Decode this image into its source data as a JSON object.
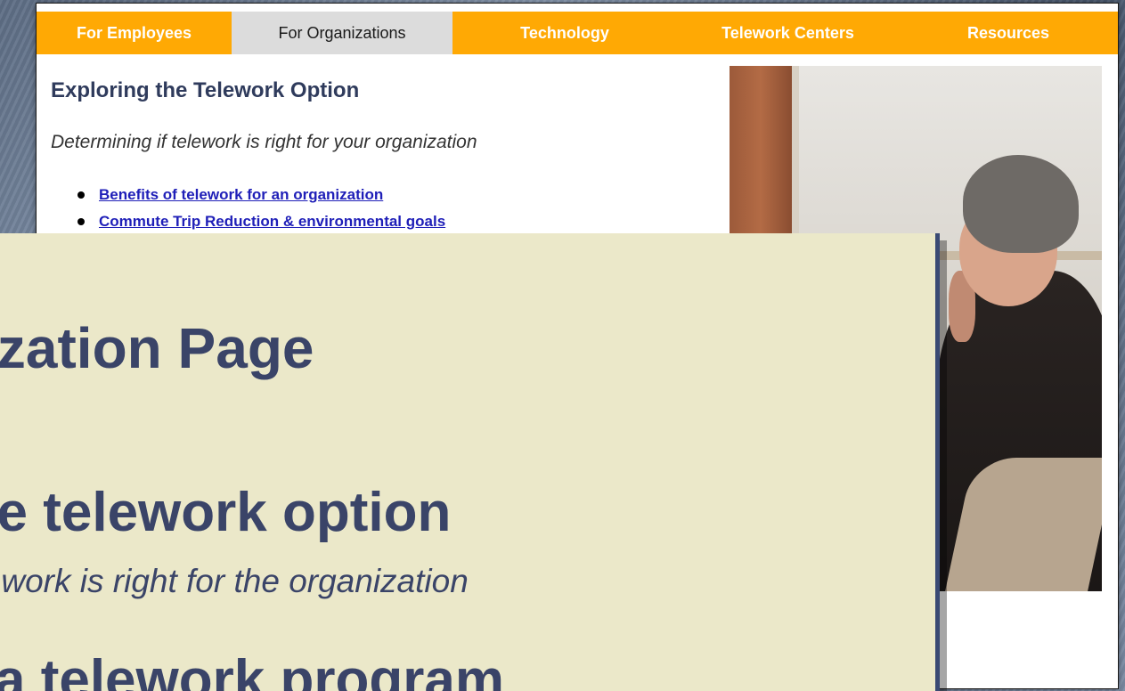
{
  "nav": {
    "tabs": [
      {
        "label": "For Employees"
      },
      {
        "label": "For Organizations"
      },
      {
        "label": "Technology"
      },
      {
        "label": "Telework Centers"
      },
      {
        "label": "Resources"
      }
    ],
    "active_tab": "For Organizations"
  },
  "content": {
    "title": "Exploring the Telework Option",
    "subtitle": "Determining if telework is right for your organization",
    "links": [
      {
        "label": "Benefits of telework for an organization"
      },
      {
        "label": "Commute Trip Reduction & environmental goals"
      }
    ]
  },
  "overlay": {
    "title": "nization Page",
    "heading": "the telework option",
    "subheading": "elework is right for the organization",
    "heading2": "a telework program"
  },
  "colors": {
    "nav_bar": "#ffa904",
    "nav_active": "#dcdcdc",
    "overlay_bg": "#ebe8c9",
    "overlay_text": "#3a4468",
    "link": "#1f1fb8"
  }
}
